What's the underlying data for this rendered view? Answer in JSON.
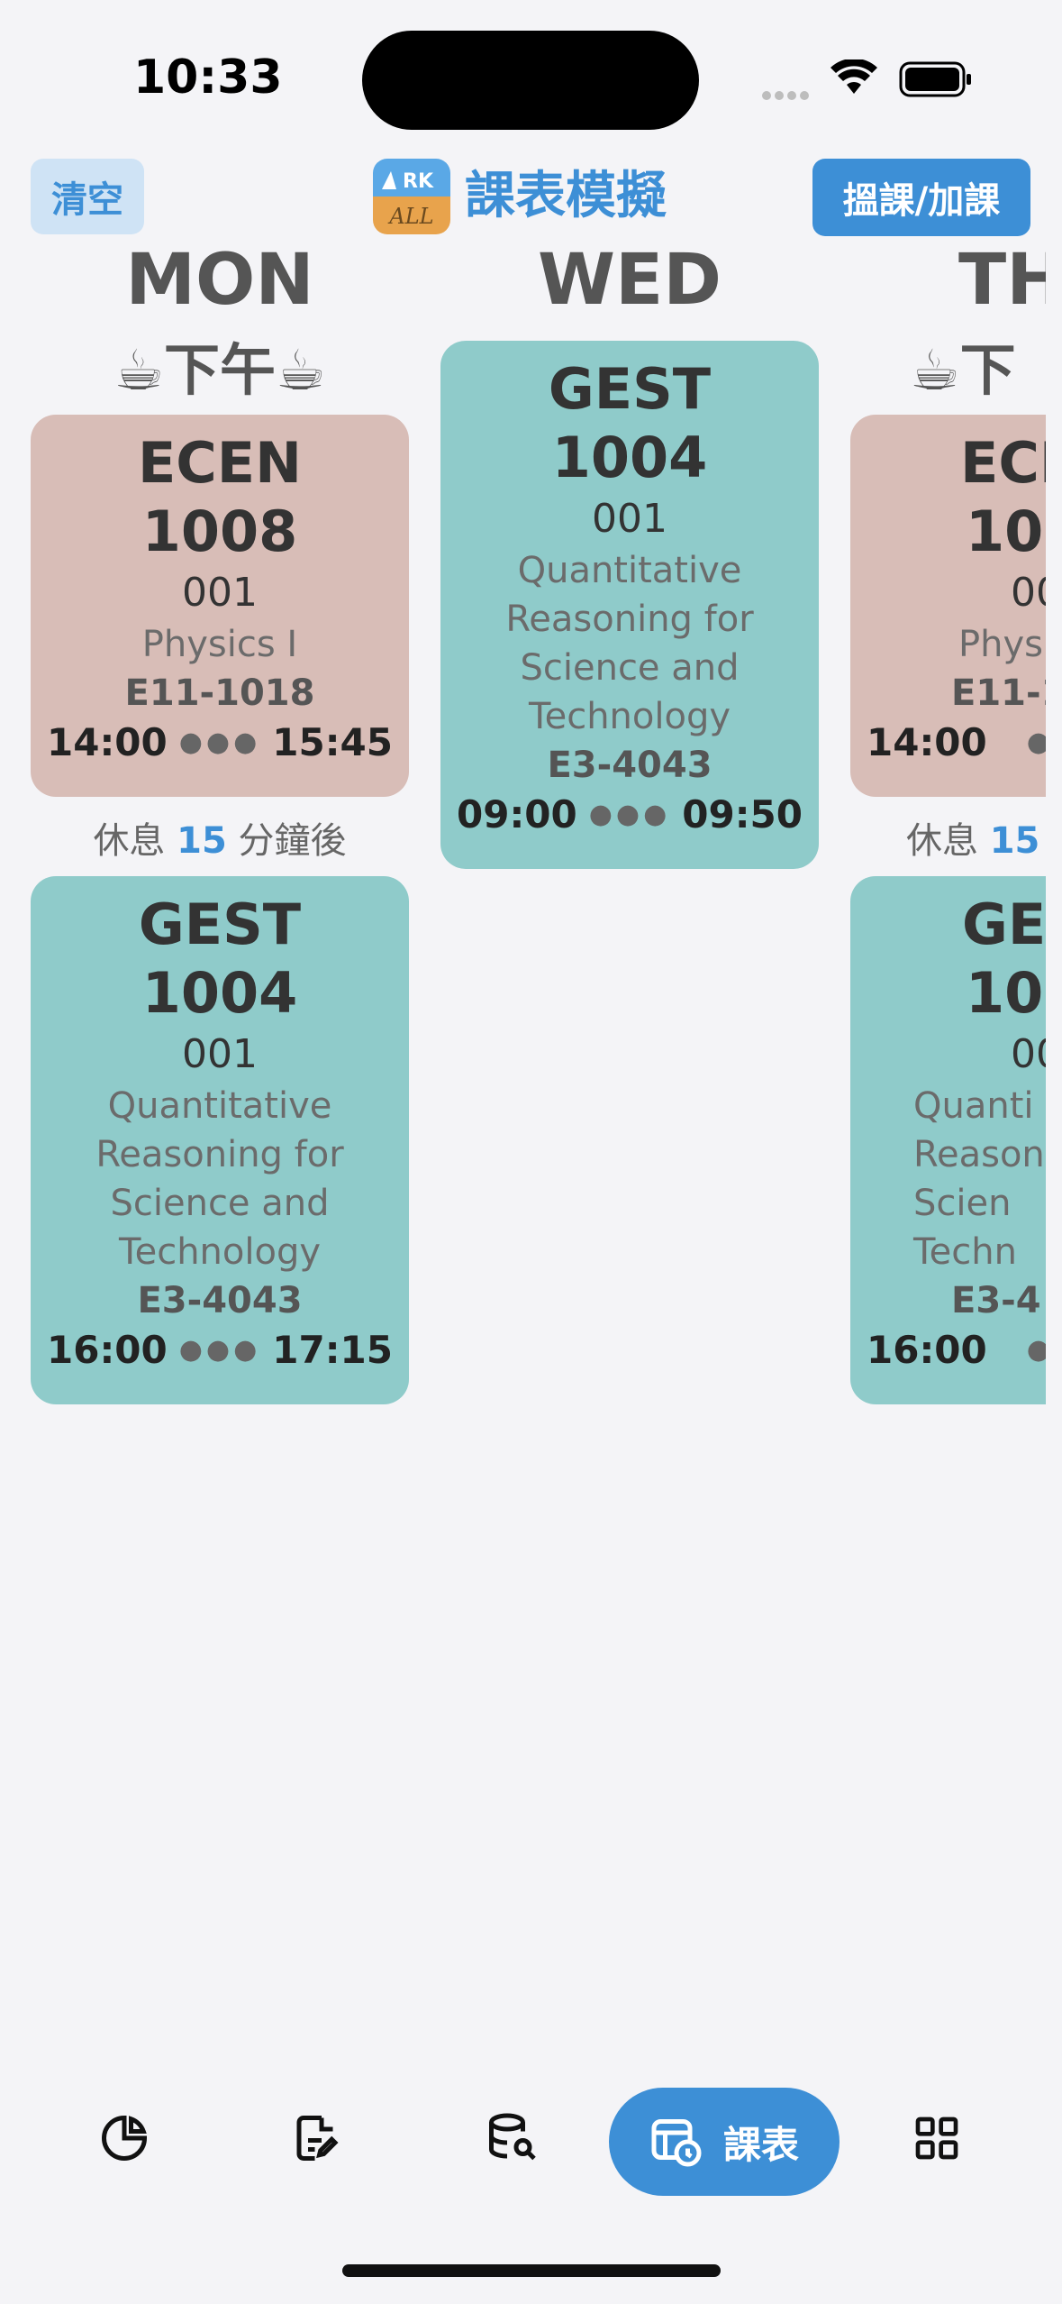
{
  "status": {
    "time": "10:33"
  },
  "header": {
    "clear_label": "清空",
    "logo_text_top": "RK",
    "logo_text_bottom": "ALL",
    "title": "課表模擬",
    "add_label": "搵課/加課"
  },
  "days": [
    {
      "name": "MON",
      "period": "☕下午☕",
      "courses": [
        {
          "code": "ECEN",
          "number": "1008",
          "section": "001",
          "name": "Physics I",
          "room": "E11-1018",
          "start": "14:00",
          "end": "15:45",
          "color": "#d8bdb7"
        },
        {
          "code": "GEST",
          "number": "1004",
          "section": "001",
          "name": "Quantitative Reasoning for Science and Technology",
          "room": "E3-4043",
          "start": "16:00",
          "end": "17:15",
          "color": "#8fcbca"
        }
      ],
      "break": {
        "prefix": "休息",
        "minutes": "15",
        "suffix": "分鐘後"
      }
    },
    {
      "name": "WED",
      "courses": [
        {
          "code": "GEST",
          "number": "1004",
          "section": "001",
          "name": "Quantitative Reasoning for Science and Technology",
          "room": "E3-4043",
          "start": "09:00",
          "end": "09:50",
          "color": "#8fcbca"
        }
      ]
    },
    {
      "name": "TH",
      "period": "☕下",
      "courses": [
        {
          "code": "ECI",
          "number": "10",
          "section": "00",
          "name": "Phys",
          "room": "E11-1",
          "start": "14:00",
          "end": "",
          "color": "#d8bdb7"
        },
        {
          "code": "GE",
          "number": "10",
          "section": "00",
          "name": "Quanti Reason Scien Techn",
          "room": "E3-4",
          "start": "16:00",
          "end": "",
          "color": "#8fcbca"
        }
      ],
      "break": {
        "prefix": "休息",
        "minutes": "15",
        "suffix": ""
      }
    }
  ],
  "tabbar": {
    "active_label": "課表",
    "icons": [
      "pie-chart-icon",
      "edit-document-icon",
      "database-search-icon",
      "timetable-icon",
      "grid-icon"
    ]
  },
  "colors": {
    "accent": "#3d8fd6",
    "ecen": "#d8bdb7",
    "gest": "#8fcbca",
    "background": "#f4f4f7"
  }
}
